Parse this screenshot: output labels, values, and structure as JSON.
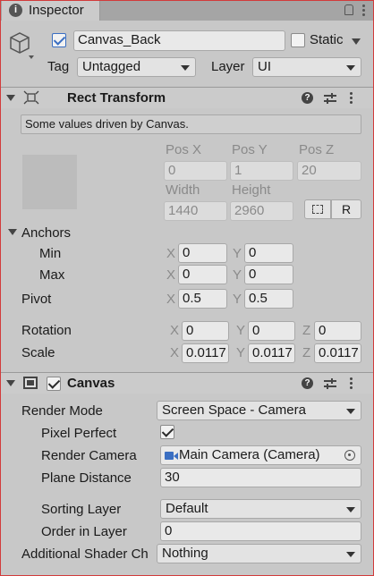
{
  "window": {
    "tab_label": "Inspector"
  },
  "object": {
    "name": "Canvas_Back",
    "active": true,
    "static_label": "Static",
    "static_checked": false,
    "tag_label": "Tag",
    "tag_value": "Untagged",
    "layer_label": "Layer",
    "layer_value": "UI"
  },
  "rect_transform": {
    "title": "Rect Transform",
    "info": "Some values driven by Canvas.",
    "pos_x_label": "Pos X",
    "pos_y_label": "Pos Y",
    "pos_z_label": "Pos Z",
    "pos_x": "0",
    "pos_y": "1",
    "pos_z": "20",
    "width_label": "Width",
    "height_label": "Height",
    "width": "1440",
    "height": "2960",
    "r_button": "R",
    "anchors_label": "Anchors",
    "min_label": "Min",
    "max_label": "Max",
    "anchor_min_x": "0",
    "anchor_min_y": "0",
    "anchor_max_x": "0",
    "anchor_max_y": "0",
    "pivot_label": "Pivot",
    "pivot_x": "0.5",
    "pivot_y": "0.5",
    "rotation_label": "Rotation",
    "rot_x": "0",
    "rot_y": "0",
    "rot_z": "0",
    "scale_label": "Scale",
    "scale_x": "0.0117",
    "scale_y": "0.0117",
    "scale_z": "0.0117",
    "axis_x": "X",
    "axis_y": "Y",
    "axis_z": "Z"
  },
  "canvas": {
    "title": "Canvas",
    "enabled": true,
    "render_mode_label": "Render Mode",
    "render_mode_value": "Screen Space - Camera",
    "pixel_perfect_label": "Pixel Perfect",
    "pixel_perfect": true,
    "render_camera_label": "Render Camera",
    "render_camera_value": "Main Camera (Camera)",
    "plane_distance_label": "Plane Distance",
    "plane_distance_value": "30",
    "sorting_layer_label": "Sorting Layer",
    "sorting_layer_value": "Default",
    "order_in_layer_label": "Order in Layer",
    "order_in_layer_value": "0",
    "additional_shader_label": "Additional Shader Ch",
    "additional_shader_value": "Nothing"
  }
}
